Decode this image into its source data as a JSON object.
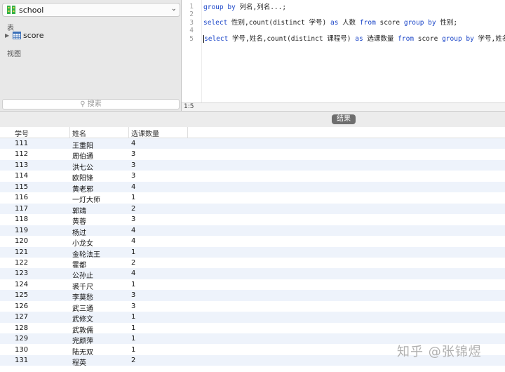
{
  "sidebar": {
    "database": "school",
    "tables_label": "表",
    "table_items": [
      "score"
    ],
    "views_label": "视图",
    "search_placeholder": "搜索"
  },
  "editor": {
    "line_numbers": [
      "1",
      "2",
      "3",
      "4",
      "5"
    ],
    "lines": [
      [
        {
          "t": "group by",
          "k": 1
        },
        {
          "t": " 列名,列名...;",
          "k": 0
        }
      ],
      [],
      [
        {
          "t": "select",
          "k": 1
        },
        {
          "t": " 性别,count(distinct 学号) ",
          "k": 0
        },
        {
          "t": "as",
          "k": 1
        },
        {
          "t": " 人数 ",
          "k": 0
        },
        {
          "t": "from",
          "k": 1
        },
        {
          "t": " score ",
          "k": 0
        },
        {
          "t": "group by",
          "k": 1
        },
        {
          "t": " 性别;",
          "k": 0
        }
      ],
      [],
      [
        {
          "t": "select",
          "k": 1
        },
        {
          "t": " 学号,姓名,count(distinct 课程号) ",
          "k": 0
        },
        {
          "t": "as",
          "k": 1
        },
        {
          "t": " 选课数量 ",
          "k": 0
        },
        {
          "t": "from",
          "k": 1
        },
        {
          "t": " score ",
          "k": 0
        },
        {
          "t": "group by",
          "k": 1
        },
        {
          "t": " 学号,姓名;",
          "k": 0
        }
      ]
    ],
    "cursor_position": "1:5"
  },
  "results": {
    "button_label": "结果",
    "columns": [
      "学号",
      "姓名",
      "选课数量"
    ],
    "rows": [
      [
        "111",
        "王重阳",
        "4"
      ],
      [
        "112",
        "周伯通",
        "3"
      ],
      [
        "113",
        "洪七公",
        "3"
      ],
      [
        "114",
        "欧阳锋",
        "3"
      ],
      [
        "115",
        "黄老邪",
        "4"
      ],
      [
        "116",
        "一灯大师",
        "1"
      ],
      [
        "117",
        "郭靖",
        "2"
      ],
      [
        "118",
        "黄蓉",
        "3"
      ],
      [
        "119",
        "杨过",
        "4"
      ],
      [
        "120",
        "小龙女",
        "4"
      ],
      [
        "121",
        "金轮法王",
        "1"
      ],
      [
        "122",
        "霍都",
        "2"
      ],
      [
        "123",
        "公孙止",
        "4"
      ],
      [
        "124",
        "裘千尺",
        "1"
      ],
      [
        "125",
        "李莫愁",
        "3"
      ],
      [
        "126",
        "武三通",
        "3"
      ],
      [
        "127",
        "武修文",
        "1"
      ],
      [
        "128",
        "武敦儒",
        "1"
      ],
      [
        "129",
        "完颜萍",
        "1"
      ],
      [
        "130",
        "陆无双",
        "1"
      ],
      [
        "131",
        "程英",
        "2"
      ]
    ]
  },
  "watermark": "知乎 @张锦煜",
  "colors": {
    "keyword": "#1a45c8",
    "selection": "#b8d3f5",
    "row_alt": "#eef3fb",
    "db_icon": "#36b14a"
  }
}
